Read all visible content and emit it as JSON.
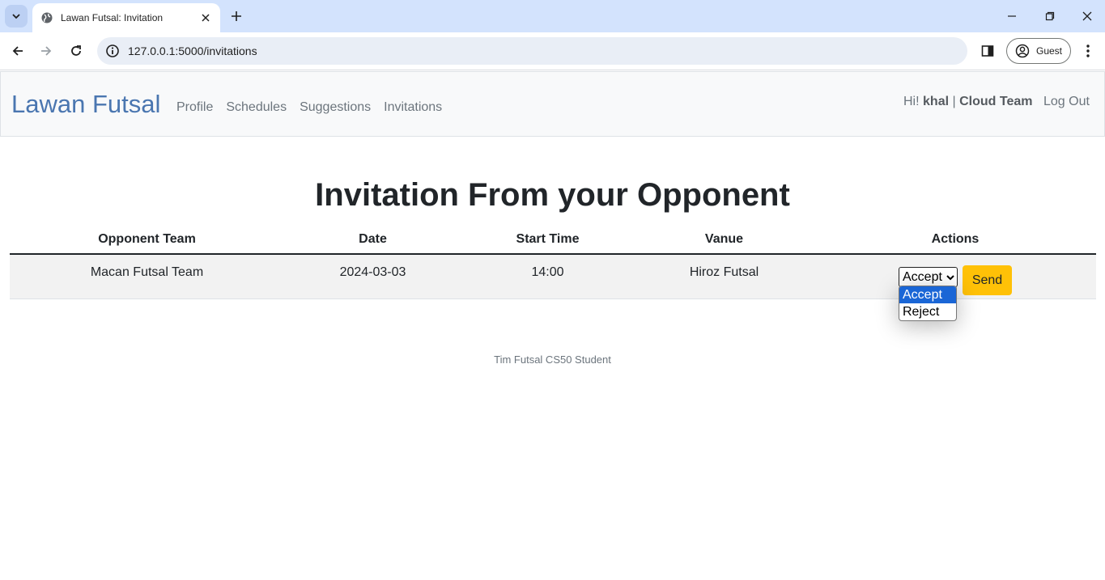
{
  "browser": {
    "tab_title": "Lawan Futsal: Invitation",
    "url": "127.0.0.1:5000/invitations",
    "profile_label": "Guest"
  },
  "navbar": {
    "brand": "Lawan Futsal",
    "links": [
      "Profile",
      "Schedules",
      "Suggestions",
      "Invitations"
    ],
    "greeting_prefix": "Hi!",
    "username": "khal",
    "separator": "|",
    "team": "Cloud Team",
    "logout": "Log Out"
  },
  "main": {
    "title": "Invitation From your Opponent",
    "table": {
      "headers": [
        "Opponent Team",
        "Date",
        "Start Time",
        "Vanue",
        "Actions"
      ],
      "rows": [
        {
          "opponent": "Macan Futsal Team",
          "date": "2024-03-03",
          "start_time": "14:00",
          "venue": "Hiroz Futsal",
          "selected_action": "Accept",
          "send_label": "Send"
        }
      ]
    },
    "dropdown_options": [
      "Accept",
      "Reject"
    ]
  },
  "footer": {
    "text": "Tim Futsal CS50 Student"
  },
  "colors": {
    "brand": "#4a76b0",
    "send_button": "#ffc107",
    "option_highlight": "#1a66d6",
    "tabstrip": "#d3e3fd"
  }
}
